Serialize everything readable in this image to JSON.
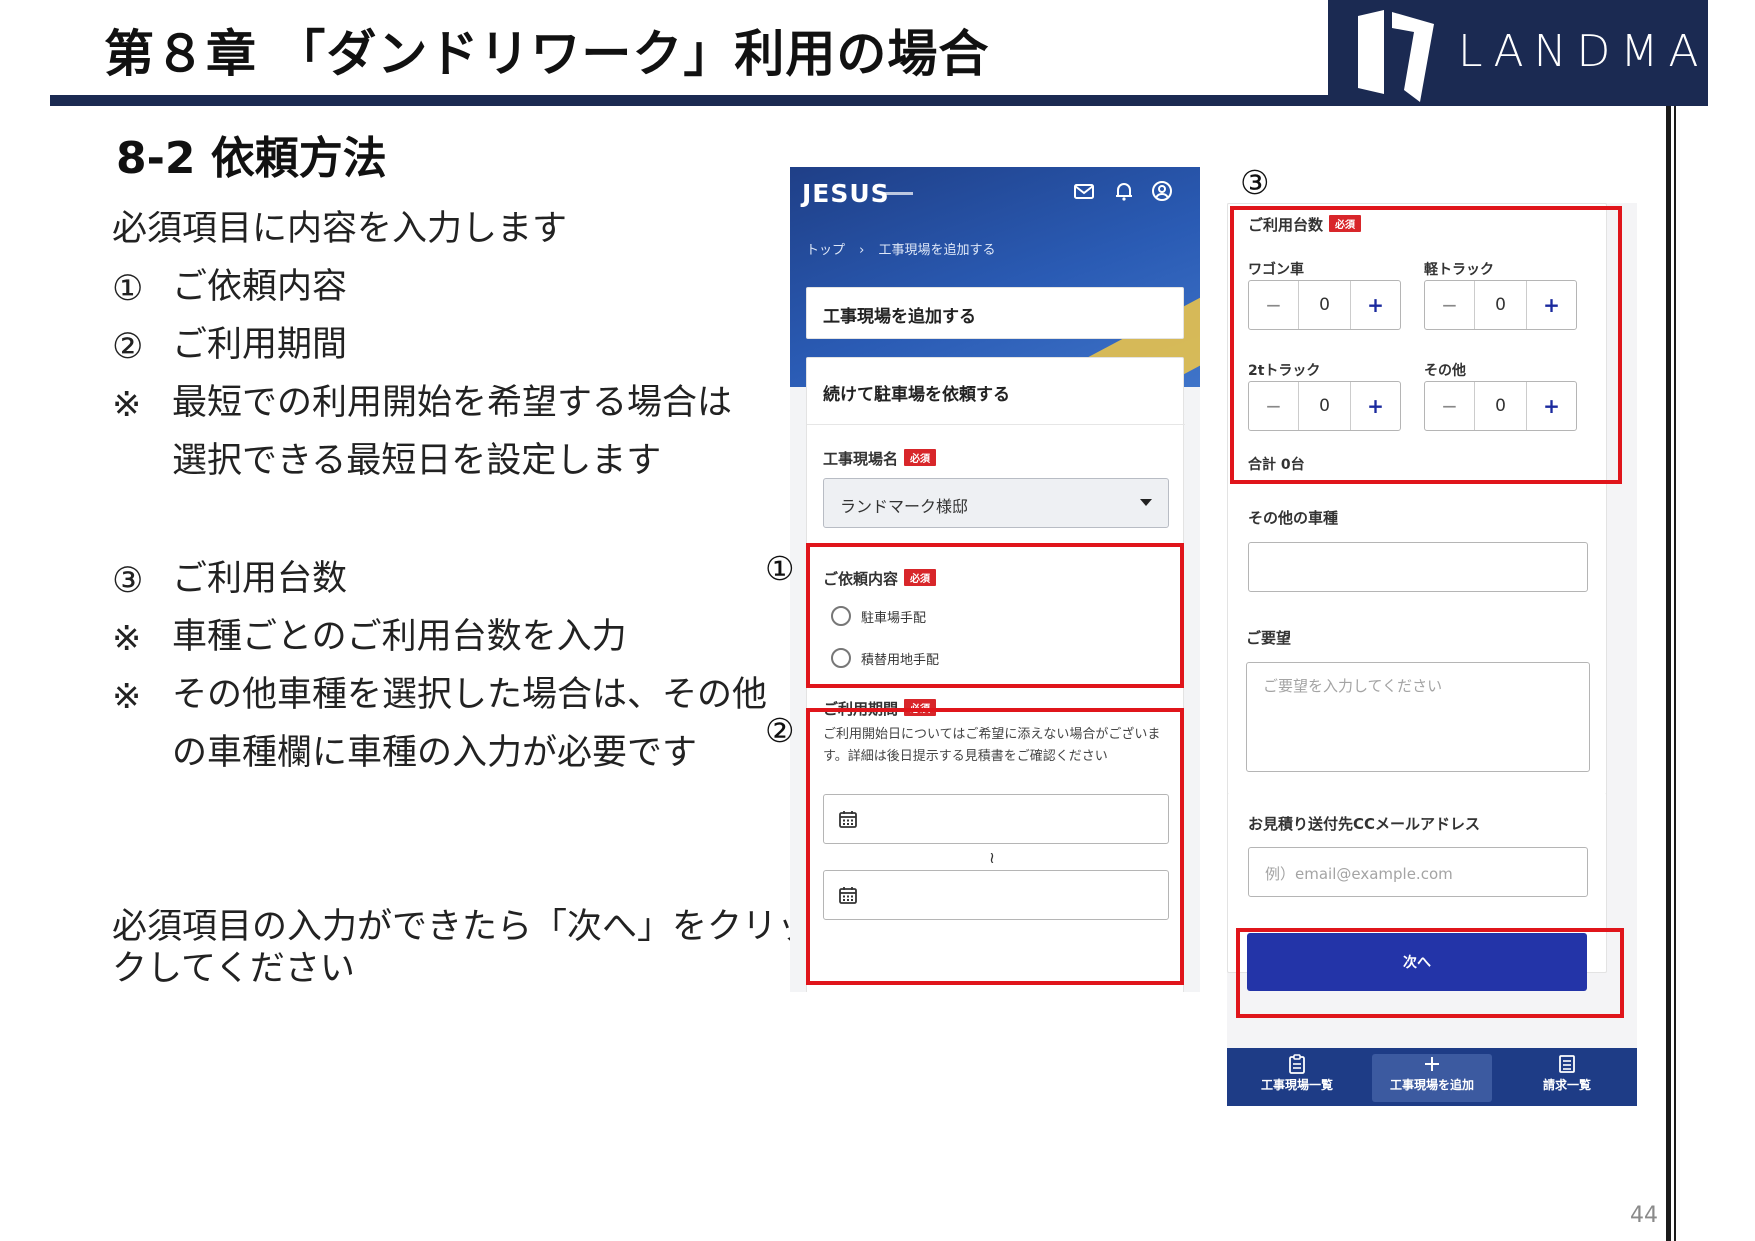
{
  "slide": {
    "chapter_title": "第８章 「ダンドリワーク」利用の場合",
    "section_title": "8-2  依頼方法",
    "logo_text": "LANDMARK",
    "page_number": "44"
  },
  "instructions": {
    "intro": "必須項目に内容を入力します",
    "item1_mark": "①",
    "item1_text": "ご依頼内容",
    "item2_mark": "②",
    "item2_text": "ご利用期間",
    "note1_mark": "※",
    "note1_line1": "最短での利用開始を希望する場合は",
    "note1_line2": "選択できる最短日を設定します",
    "item3_mark": "③",
    "item3_text": "ご利用台数",
    "note2_mark": "※",
    "note2_text": "車種ごとのご利用台数を入力",
    "note3_mark": "※",
    "note3_line1": "その他車種を選択した場合は、その他",
    "note3_line2": "の車種欄に車種の入力が必要です",
    "outro_line1": "必須項目の入力ができたら「次へ」をクリッ",
    "outro_line2": "クしてください"
  },
  "callouts": {
    "c1": "①",
    "c2": "②",
    "c3": "③"
  },
  "form1": {
    "app_logo": "JESUS",
    "breadcrumb_home": "トップ",
    "breadcrumb_sep": "›",
    "breadcrumb_current": "工事現場を追加する",
    "page_heading": "工事現場を追加する",
    "sub_heading": "続けて駐車場を依頼する",
    "site_name_label": "工事現場名",
    "required_badge": "必須",
    "site_name_value": "ランドマーク様邸",
    "request_label": "ご依頼内容",
    "radio_options": [
      "駐車場手配",
      "積替用地手配"
    ],
    "period_label": "ご利用期間",
    "period_note": "ご利用開始日についてはご希望に添えない場合がございます。詳細は後日提示する見積書をご確認ください",
    "range_sep": "≀"
  },
  "form2": {
    "count_label": "ご利用台数",
    "required_badge": "必須",
    "vehicles": [
      {
        "name": "ワゴン車",
        "count": "0"
      },
      {
        "name": "軽トラック",
        "count": "0"
      },
      {
        "name": "2tトラック",
        "count": "0"
      },
      {
        "name": "その他",
        "count": "0"
      }
    ],
    "minus": "−",
    "plus": "+",
    "total": "合計 0台",
    "other_type_label": "その他の車種",
    "request_label": "ご要望",
    "request_placeholder": "ご要望を入力してください",
    "cc_label": "お見積り送付先CCメールアドレス",
    "cc_placeholder": "例）email@example.com",
    "next_button": "次へ"
  },
  "tabbar": {
    "tabs": [
      {
        "label": "工事現場一覧",
        "icon": "clipboard-icon"
      },
      {
        "label": "工事現場を追加",
        "icon": "plus-icon"
      },
      {
        "label": "請求一覧",
        "icon": "list-icon"
      }
    ]
  },
  "colors": {
    "navy": "#1b2a52",
    "highlight_red": "#e0151b",
    "required_red": "#d8262a",
    "button_blue": "#2334a8"
  }
}
